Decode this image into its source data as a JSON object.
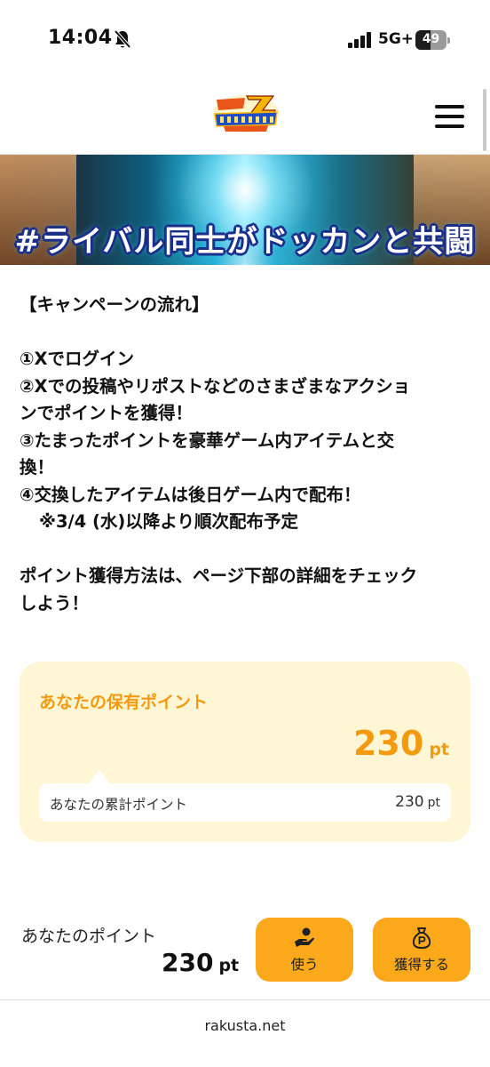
{
  "status_bar": {
    "time": "14:04",
    "network": "5G+",
    "battery": "49",
    "battery_level_percent": 49,
    "icons": [
      "bell-muted-icon",
      "cellular-signal-icon",
      "battery-icon"
    ]
  },
  "header": {
    "logo_text": "DRAGON BALL Z DOKKAN BATTLE",
    "icons": [
      "hamburger-menu-icon"
    ]
  },
  "banner": {
    "title": "#ライバル同士がドッカンと共闘"
  },
  "campaign_flow": {
    "heading": "【キャンペーンの流れ】",
    "steps": [
      "①Xでログイン",
      "②Xでの投稿やリポストなどのさまざまなアクショ",
      "ンでポイントを獲得！",
      "③たまったポイントを豪華ゲーム内アイテムと交",
      "換！",
      "④交換したアイテムは後日ゲーム内で配布！"
    ],
    "note": "※3/4 (水)以降より順次配布予定",
    "howto_lines": [
      "ポイント獲得方法は、ページ下部の詳細をチェック",
      "しよう！"
    ]
  },
  "points_card": {
    "title": "あなたの保有ポイント",
    "value": "230",
    "unit": "pt",
    "cumulative_label": "あなたの累計ポイント",
    "cumulative_value": "230",
    "cumulative_unit": "pt"
  },
  "bottom_bar": {
    "label": "あなたのポイント",
    "value": "230",
    "unit": "pt",
    "use_button": "使う",
    "earn_button": "獲得する",
    "icons": [
      "hand-coin-icon",
      "point-bag-icon"
    ]
  },
  "footer": {
    "domain": "rakusta.net"
  },
  "colors": {
    "accent": "#f39a10",
    "button": "#fba81a",
    "card_bg": "#fff6d6"
  }
}
